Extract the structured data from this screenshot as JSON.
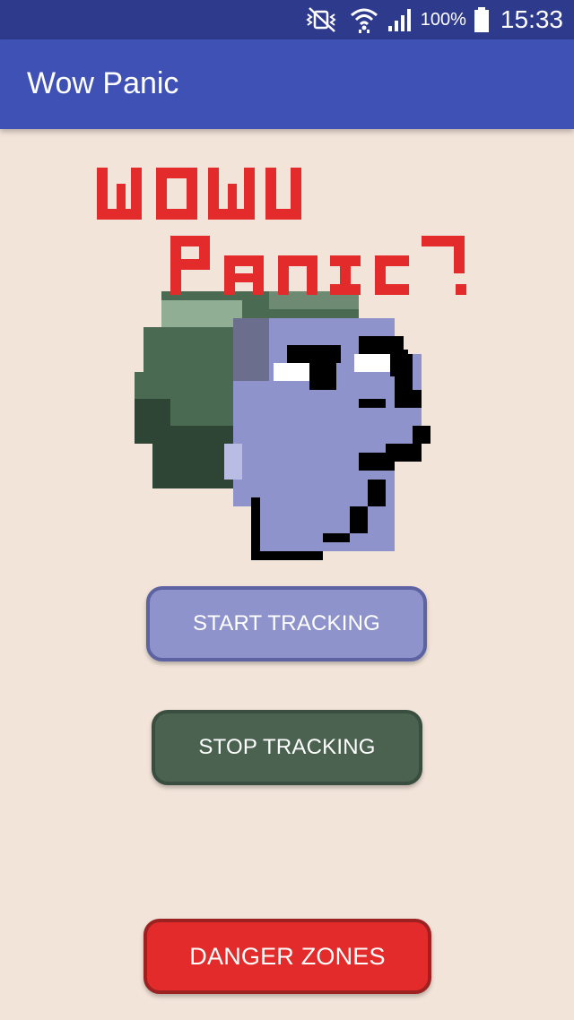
{
  "status_bar": {
    "battery_percent": "100%",
    "time": "15:33",
    "icons": [
      "mute-vibrate-icon",
      "wifi-icon",
      "signal-icon",
      "battery-icon"
    ]
  },
  "app_bar": {
    "title": "Wow Panic"
  },
  "logo": {
    "line1": "WOW",
    "line2": "PANIC!",
    "text_color": "#e32b2b"
  },
  "buttons": {
    "start_tracking": "START TRACKING",
    "stop_tracking": "STOP TRACKING",
    "danger_zones": "DANGER ZONES"
  },
  "colors": {
    "status_bar": "#2e3a8c",
    "app_bar": "#3f51b5",
    "background": "#f2e4d9",
    "start_button": "#8e94cb",
    "stop_button": "#4a624f",
    "danger_button": "#e32b2b"
  }
}
